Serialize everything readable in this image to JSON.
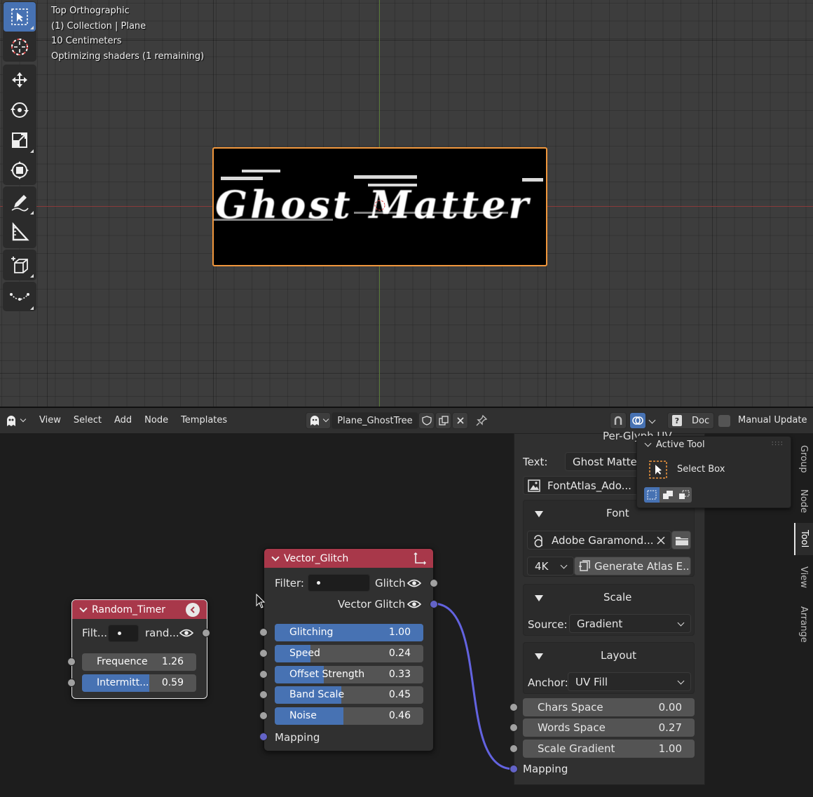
{
  "viewport": {
    "overlay": {
      "view_name": "Top Orthographic",
      "collection": "(1) Collection | Plane",
      "scale": "10 Centimeters",
      "status": "Optimizing shaders (1 remaining)"
    },
    "plane_text": "Ghost Matter",
    "tools": [
      "select-box",
      "cursor",
      "move",
      "rotate",
      "scale",
      "transform",
      "annotate",
      "measure",
      "add-cube",
      "extrude"
    ]
  },
  "node_editor": {
    "menu": [
      "View",
      "Select",
      "Add",
      "Node",
      "Templates"
    ],
    "tree_name": "Plane_GhostTree",
    "doc_label": "Doc",
    "manual_update_label": "Manual Update",
    "nodes": {
      "random_timer": {
        "title": "Random_Timer",
        "filter_label": "Filt...",
        "output_label": "rand...",
        "fields": [
          {
            "label": "Frequence",
            "value": "1.26",
            "fill": 0.0
          },
          {
            "label": "Intermitt...",
            "value": "0.59",
            "fill": 0.59
          }
        ]
      },
      "vector_glitch": {
        "title": "Vector_Glitch",
        "filter_label": "Filter:",
        "output_glitch": "Glitch",
        "output_vector": "Vector Glitch",
        "fields": [
          {
            "label": "Glitching",
            "value": "1.00",
            "fill": 1.0
          },
          {
            "label": "Speed",
            "value": "0.24",
            "fill": 0.24
          },
          {
            "label": "Offset Strength",
            "value": "0.33",
            "fill": 0.33
          },
          {
            "label": "Band Scale",
            "value": "0.45",
            "fill": 0.45
          },
          {
            "label": "Noise",
            "value": "0.46",
            "fill": 0.46
          }
        ],
        "input_mapping": "Mapping"
      }
    },
    "sidebar": {
      "partial_title": "Per-Glyph UV",
      "text_label": "Text:",
      "text_value": "Ghost Matter",
      "image_name": "FontAtlas_Ado...",
      "font_panel": {
        "title": "Font",
        "font_name": "Adobe Garamond...",
        "resolution": "4K",
        "generate_label": "Generate Atlas E..."
      },
      "scale_panel": {
        "title": "Scale",
        "source_label": "Source:",
        "source_value": "Gradient"
      },
      "layout_panel": {
        "title": "Layout",
        "anchor_label": "Anchor:",
        "anchor_value": "UV Fill"
      },
      "fields": [
        {
          "label": "Chars Space",
          "value": "0.00"
        },
        {
          "label": "Words Space",
          "value": "0.27"
        },
        {
          "label": "Scale Gradient",
          "value": "1.00"
        }
      ],
      "mapping_label": "Mapping"
    },
    "active_tool": {
      "title": "Active Tool",
      "tool_name": "Select Box"
    },
    "tabs": [
      "Group",
      "Node",
      "Tool",
      "View",
      "Arrange"
    ],
    "active_tab": "Tool"
  }
}
